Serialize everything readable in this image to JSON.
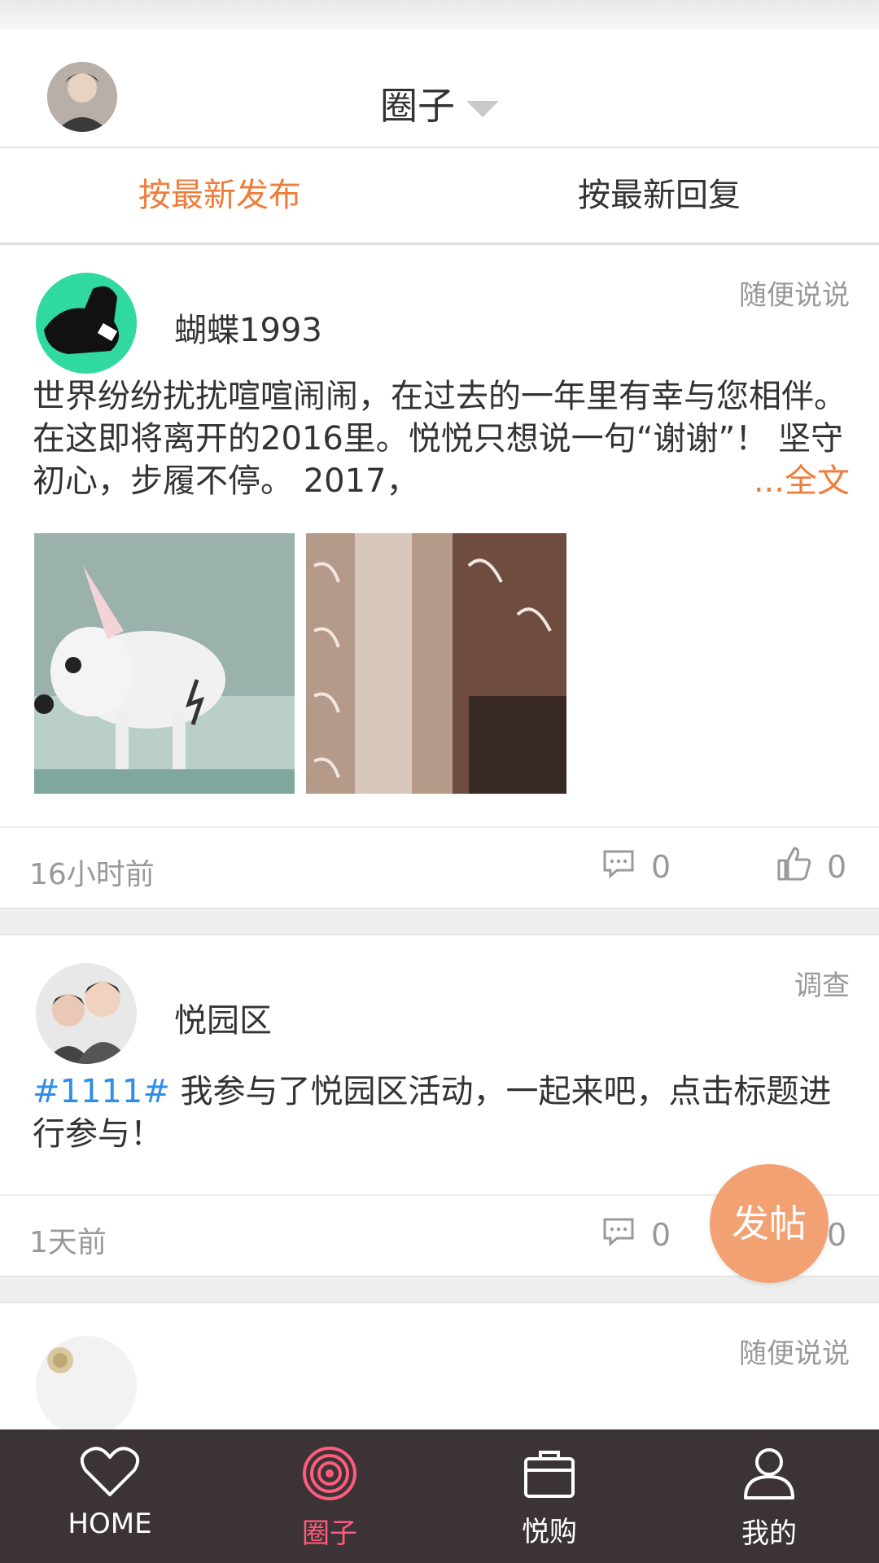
{
  "header": {
    "title": "圈子"
  },
  "tabs": [
    {
      "label": "按最新发布",
      "active": true
    },
    {
      "label": "按最新回复",
      "active": false
    }
  ],
  "posts": [
    {
      "user": "蝴蝶1993",
      "tag": "随便说说",
      "text": "世界纷纷扰扰喧喧闹闹，在过去的一年里有幸与您相伴。 在这即将离开的2016里。悦悦只想说一句“谢谢”！ 坚守初心，步履不停。 2017，",
      "more_label": "...全文",
      "time": "16小时前",
      "comments": "0",
      "likes": "0"
    },
    {
      "user": "悦园区",
      "tag": "调查",
      "hashtag": "#1111#",
      "text": " 我参与了悦园区活动，一起来吧，点击标题进行参与！",
      "time": "1天前",
      "comments": "0",
      "likes": "0"
    },
    {
      "tag": "随便说说"
    }
  ],
  "fab": {
    "label": "发帖"
  },
  "nav": [
    {
      "label": "HOME",
      "icon": "heart-icon"
    },
    {
      "label": "圈子",
      "icon": "target-icon",
      "active": true
    },
    {
      "label": "悦购",
      "icon": "bag-icon"
    },
    {
      "label": "我的",
      "icon": "user-icon"
    }
  ],
  "colors": {
    "accent": "#f07c3a",
    "nav_bg": "#3b3335",
    "nav_active": "#ff5b7f",
    "hashtag": "#2e8ee8"
  }
}
